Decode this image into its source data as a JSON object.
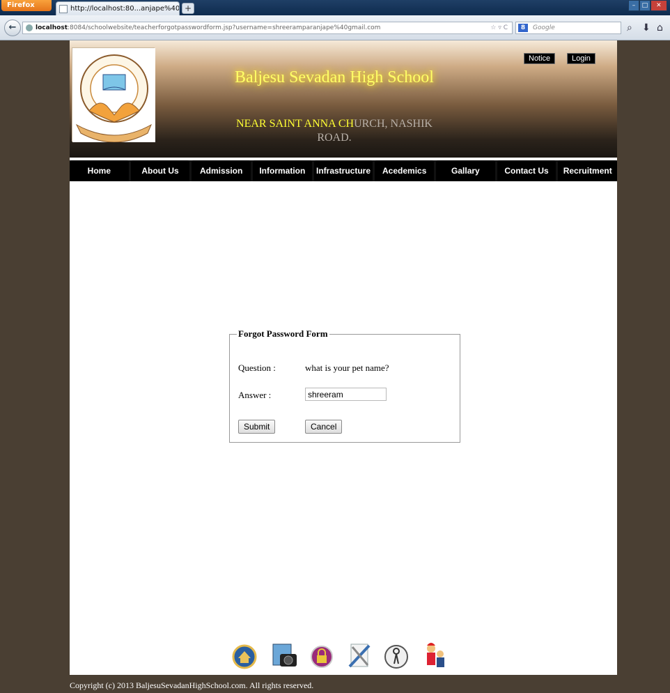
{
  "browser": {
    "app_button": "Firefox",
    "tab_title": "http://localhost:80...anjape%40gmail.com",
    "new_tab": "+",
    "url_host": "localhost",
    "url_rest": ":8084/schoolwebsite/teacherforgotpasswordform.jsp?username=shreeramparanjape%40gmail.com",
    "search_placeholder": "Google"
  },
  "header": {
    "school_name": "Baljesu Sevadan High School",
    "address_bright": "NEAR SAINT ANNA CH",
    "address_faded": "URCH, NASHIK ROAD.",
    "notice_label": "Notice",
    "login_label": "Login"
  },
  "menu": {
    "items": [
      "Home",
      "About Us",
      "Admission",
      "Information",
      "Infrastructure",
      "Acedemics",
      "Gallary",
      "Contact Us",
      "Recruitment"
    ]
  },
  "form": {
    "legend": "Forgot Password Form",
    "question_label": "Question :",
    "question_value": "what is your pet name?",
    "answer_label": "Answer :",
    "answer_value": "shreeram",
    "submit_label": "Submit",
    "cancel_label": "Cancel"
  },
  "footer": {
    "icons": [
      "home-icon",
      "camera-icon",
      "lock-icon",
      "tools-icon",
      "keys-icon",
      "people-icon"
    ],
    "copyright": "Copyright (c) 2013 BaljesuSevadanHighSchool.com. All rights reserved."
  }
}
